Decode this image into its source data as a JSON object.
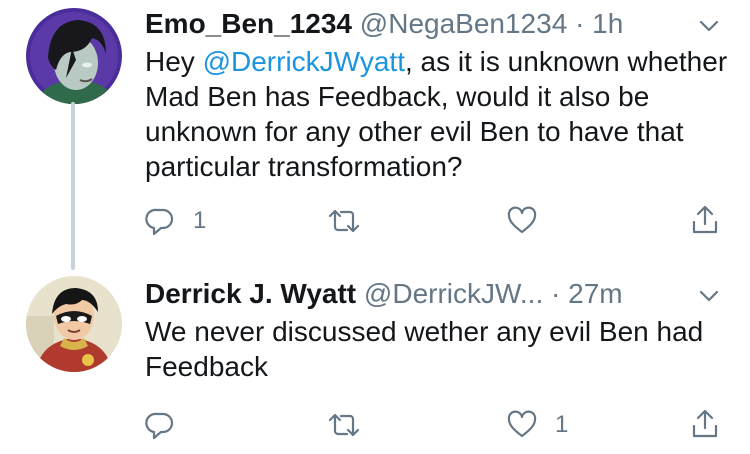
{
  "tweets": [
    {
      "display_name": "Emo_Ben_1234",
      "handle": "@NegaBen1234",
      "separator": "·",
      "time": "1h",
      "text_before": "Hey ",
      "mention": "@DerrickJWyatt",
      "text_after": ", as it is unknown whether Mad Ben has Feedback, would it also be unknown for any other evil Ben to have that particular transformation?",
      "reply_count": "1",
      "retweet_count": "",
      "like_count": ""
    },
    {
      "display_name": "Derrick J. Wyatt",
      "handle": "@DerrickJW...",
      "separator": "·",
      "time": "27m",
      "text": "We never discussed wether any evil Ben had Feedback",
      "reply_count": "",
      "retweet_count": "",
      "like_count": "1"
    }
  ],
  "icons": {
    "reply": "reply-icon",
    "retweet": "retweet-icon",
    "like": "heart-icon",
    "share": "share-icon",
    "more": "chevron-down-icon"
  },
  "colors": {
    "text": "#14171a",
    "secondary": "#657786",
    "link": "#1b95e0",
    "thread_line": "#c8d3dc"
  }
}
